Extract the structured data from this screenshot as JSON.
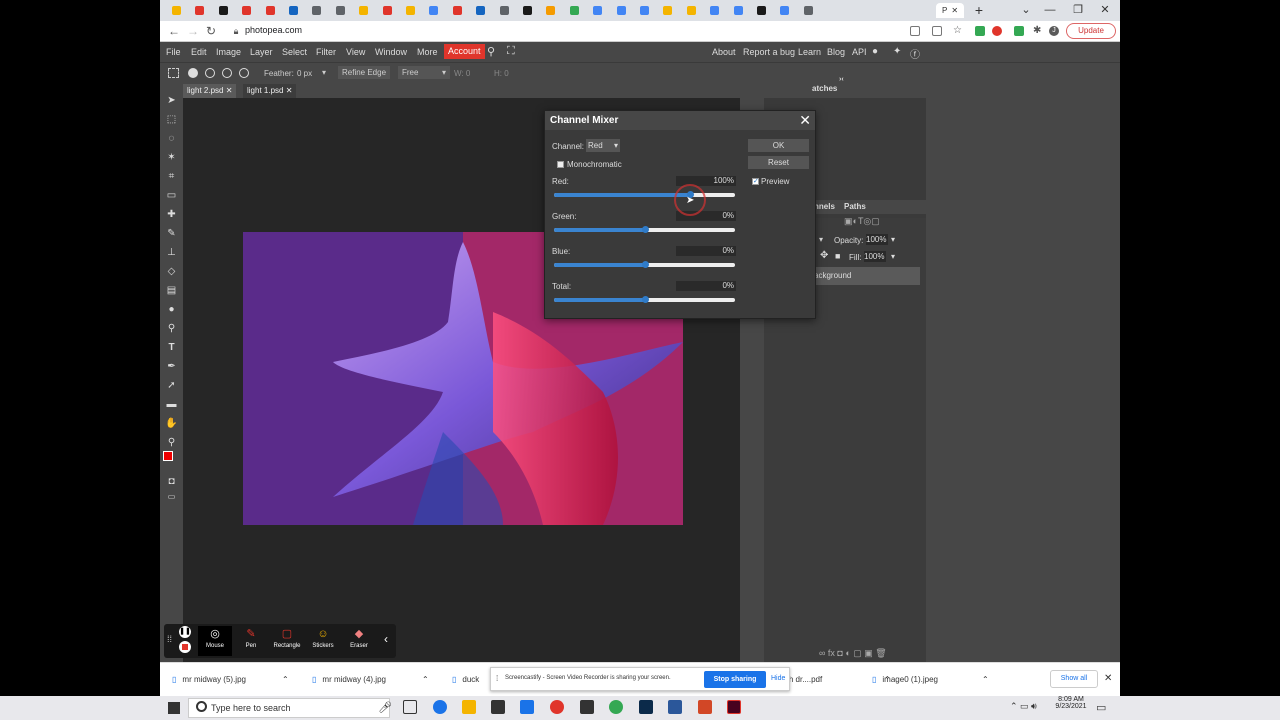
{
  "browser": {
    "tab_title": "P",
    "tab_icon_colors": [
      "#f4b400",
      "#e0352b",
      "#1a1a1a",
      "#e0352b",
      "#e0352b",
      "#1565c0",
      "#5f6368",
      "#5f6368",
      "#f4b400",
      "#e0352b",
      "#f4b400",
      "#4285f4",
      "#e0352b",
      "#1565c0",
      "#5f6368",
      "#1a1a1a",
      "#f59b00",
      "#34a853",
      "#4285f4",
      "#4285f4",
      "#4285f4",
      "#f4b400",
      "#f4b400",
      "#4285f4",
      "#4285f4",
      "#1a1a1a",
      "#4285f4",
      "#5f6368"
    ],
    "url": "photopea.com",
    "update_label": "Update",
    "new_tab": "+",
    "minimize": "—",
    "restore": "❐",
    "close": "✕"
  },
  "photopea": {
    "menu": [
      "File",
      "Edit",
      "Image",
      "Layer",
      "Select",
      "Filter",
      "View",
      "Window",
      "More"
    ],
    "account_label": "Account",
    "right_links": [
      "About",
      "Report a bug",
      "Learn",
      "Blog",
      "API"
    ],
    "options": {
      "feather_label": "Feather:",
      "feather_value": "0 px",
      "refine_edge": "Refine Edge",
      "style": "Free",
      "w_label": "W: 0",
      "h_label": "H: 0"
    },
    "doc_tabs": [
      "light 2.psd",
      "light 1.psd"
    ],
    "panels": {
      "swatches_tab": "atches",
      "channels_tab": "nnels",
      "paths_tab": "Paths",
      "opacity_label": "Opacity:",
      "opacity_value": "100%",
      "fill_label": "Fill:",
      "fill_value": "100%",
      "layer_name": "ackground"
    }
  },
  "channel_mixer": {
    "title": "Channel Mixer",
    "channel_label": "Channel:",
    "channel_value": "Red",
    "monochromatic_label": "Monochromatic",
    "monochromatic_checked": false,
    "ok_label": "OK",
    "reset_label": "Reset",
    "preview_label": "Preview",
    "preview_checked": true,
    "sliders": [
      {
        "label": "Red:",
        "value": "100%",
        "level": 0.75
      },
      {
        "label": "Green:",
        "value": "0%",
        "level": 0.5
      },
      {
        "label": "Blue:",
        "value": "0%",
        "level": 0.5
      },
      {
        "label": "Total:",
        "value": "0%",
        "level": 0.5
      }
    ]
  },
  "screencastify": {
    "tools": [
      "Mouse",
      "Pen",
      "Rectangle",
      "Stickers",
      "Eraser"
    ],
    "share_message": "Screencastify - Screen Video Recorder is sharing your screen.",
    "stop_label": "Stop sharing",
    "hide_label": "Hide"
  },
  "downloads": {
    "items": [
      "mr midway (5).jpg",
      "mr midway (4).jpg",
      "duck",
      "gh dr....pdf",
      "image0 (1).jpeg"
    ],
    "show_all": "Show all"
  },
  "taskbar": {
    "search_placeholder": "Type here to search",
    "time": "8:09 AM",
    "date": "9/23/2021"
  }
}
